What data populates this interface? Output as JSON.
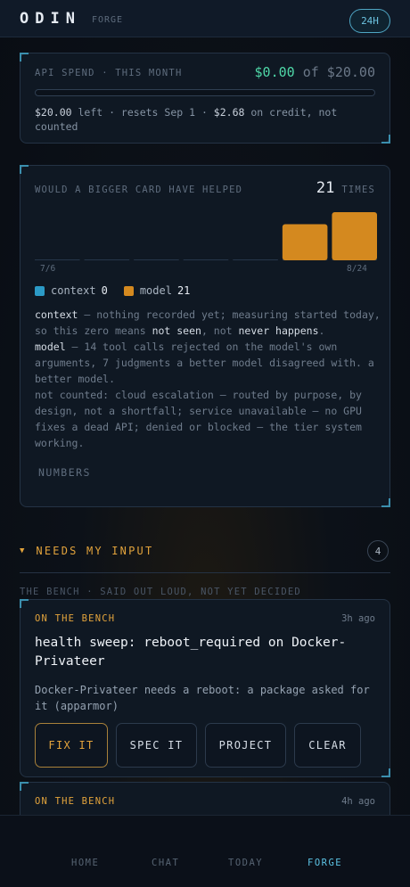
{
  "header": {
    "logo": "ODIN",
    "subtitle": "FORGE",
    "range_pill": "24H"
  },
  "spend": {
    "label": "API SPEND · THIS MONTH",
    "amount": "$0.00",
    "of_label": "of $20.00",
    "progress_fraction": 0.0,
    "note_left_amount": "$20.00",
    "note_left_text": " left · resets Sep 1 · ",
    "note_credit_amount": "$2.68",
    "note_credit_text": " on credit, not counted"
  },
  "helper": {
    "label": "WOULD A BIGGER CARD HAVE HELPED",
    "count": "21",
    "count_unit": "TIMES",
    "legend": [
      {
        "name": "context",
        "value": "0",
        "color": "#2b9ac6"
      },
      {
        "name": "model",
        "value": "21",
        "color": "#d4891f"
      }
    ],
    "explain": {
      "context_term": "context",
      "context_text_1": " — nothing recorded yet; measuring started today, so this zero means ",
      "not_seen": "not seen",
      "context_text_2": ", not ",
      "never_happens": "never happens",
      "context_text_3": ".",
      "model_term": "model",
      "model_text": " — 14 tool calls rejected on the model's own arguments, 7 judgments a better model disagreed with. a better model.",
      "not_counted": "not counted: cloud escalation — routed by purpose, by design, not a shortfall; service unavailable — no GPU fixes a dead API; denied or blocked — the tier system working."
    },
    "numbers_link": "NUMBERS"
  },
  "chart_data": {
    "type": "bar",
    "categories": [
      "7/6",
      "",
      "",
      "",
      "",
      "",
      "8/24"
    ],
    "series": [
      {
        "name": "context",
        "color": "#2b9ac6",
        "values": [
          0,
          0,
          0,
          0,
          0,
          0,
          0
        ]
      },
      {
        "name": "model",
        "color": "#d4891f",
        "values": [
          0,
          0,
          0,
          0,
          0,
          9,
          12
        ]
      }
    ],
    "x_tick_labels": [
      "7/6",
      "8/24"
    ],
    "stacked": true,
    "grid": false
  },
  "needs_input": {
    "title": "NEEDS MY INPUT",
    "count": "4",
    "bench_caption": "THE BENCH · SAID OUT LOUD, NOT YET DECIDED",
    "items": [
      {
        "tag": "ON THE BENCH",
        "time": "3h ago",
        "title": "health sweep: reboot_required on Docker-Privateer",
        "desc": "Docker-Privateer needs a reboot: a package asked for it (apparmor)",
        "actions": [
          "FIX IT",
          "SPEC IT",
          "PROJECT",
          "CLEAR"
        ]
      },
      {
        "tag": "ON THE BENCH",
        "time": "4h ago"
      }
    ]
  },
  "nav": {
    "items": [
      "HOME",
      "CHAT",
      "TODAY",
      "FORGE"
    ],
    "active": "FORGE"
  }
}
